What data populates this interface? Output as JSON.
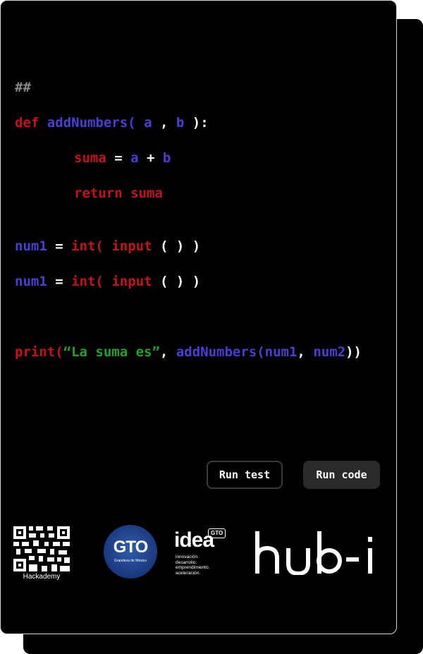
{
  "code_lines": [
    [
      {
        "t": "##",
        "c": "comment"
      }
    ],
    [
      {
        "t": "def",
        "c": "kw"
      },
      {
        "t": " ",
        "c": "plain"
      },
      {
        "t": "addNumbers(",
        "c": "fn"
      },
      {
        "t": " ",
        "c": "plain"
      },
      {
        "t": "a",
        "c": "var"
      },
      {
        "t": " , ",
        "c": "plain"
      },
      {
        "t": "b",
        "c": "var"
      },
      {
        "t": " ):",
        "c": "plain"
      }
    ],
    [
      {
        "t": "suma",
        "c": "kw"
      },
      {
        "t": " = ",
        "c": "plain"
      },
      {
        "t": "a",
        "c": "var"
      },
      {
        "t": " + ",
        "c": "plain"
      },
      {
        "t": "b",
        "c": "var"
      }
    ],
    [
      {
        "t": "return suma",
        "c": "kw"
      }
    ],
    [
      {
        "t": "num1",
        "c": "var"
      },
      {
        "t": " = ",
        "c": "plain"
      },
      {
        "t": "int(",
        "c": "kw"
      },
      {
        "t": " ",
        "c": "plain"
      },
      {
        "t": "input",
        "c": "kw"
      },
      {
        "t": " ( ) )",
        "c": "plain"
      }
    ],
    [
      {
        "t": "num1",
        "c": "var"
      },
      {
        "t": " = ",
        "c": "plain"
      },
      {
        "t": "int(",
        "c": "kw"
      },
      {
        "t": " ",
        "c": "plain"
      },
      {
        "t": "input",
        "c": "kw"
      },
      {
        "t": " ( ) )",
        "c": "plain"
      }
    ],
    [
      {
        "t": "print(",
        "c": "kw"
      },
      {
        "t": "“La suma es”",
        "c": "str"
      },
      {
        "t": ", ",
        "c": "plain"
      },
      {
        "t": "addNumbers(",
        "c": "fn"
      },
      {
        "t": "num1",
        "c": "var"
      },
      {
        "t": ", ",
        "c": "plain"
      },
      {
        "t": "num2",
        "c": "var"
      },
      {
        "t": "))",
        "c": "plain"
      }
    ]
  ],
  "buttons": {
    "run_test": "Run test",
    "run_code": "Run code"
  },
  "logos": {
    "hackademy": {
      "label": "Hackademy",
      "icon": "qr-code-icon"
    },
    "gto": {
      "text": "GTO",
      "subtitle": "Grandeza de México"
    },
    "idea": {
      "word": "idea",
      "badge": "GTO",
      "tagline": [
        "innovación.",
        "desarrollo.",
        "emprendimiento.",
        "aceleración."
      ]
    },
    "hubi": {
      "text": "hub-i"
    }
  },
  "colors": {
    "keyword": "#c4121c",
    "function": "#4a3fd0",
    "string": "#1fa22e",
    "comment": "#8a8a8a",
    "background": "#000000"
  }
}
